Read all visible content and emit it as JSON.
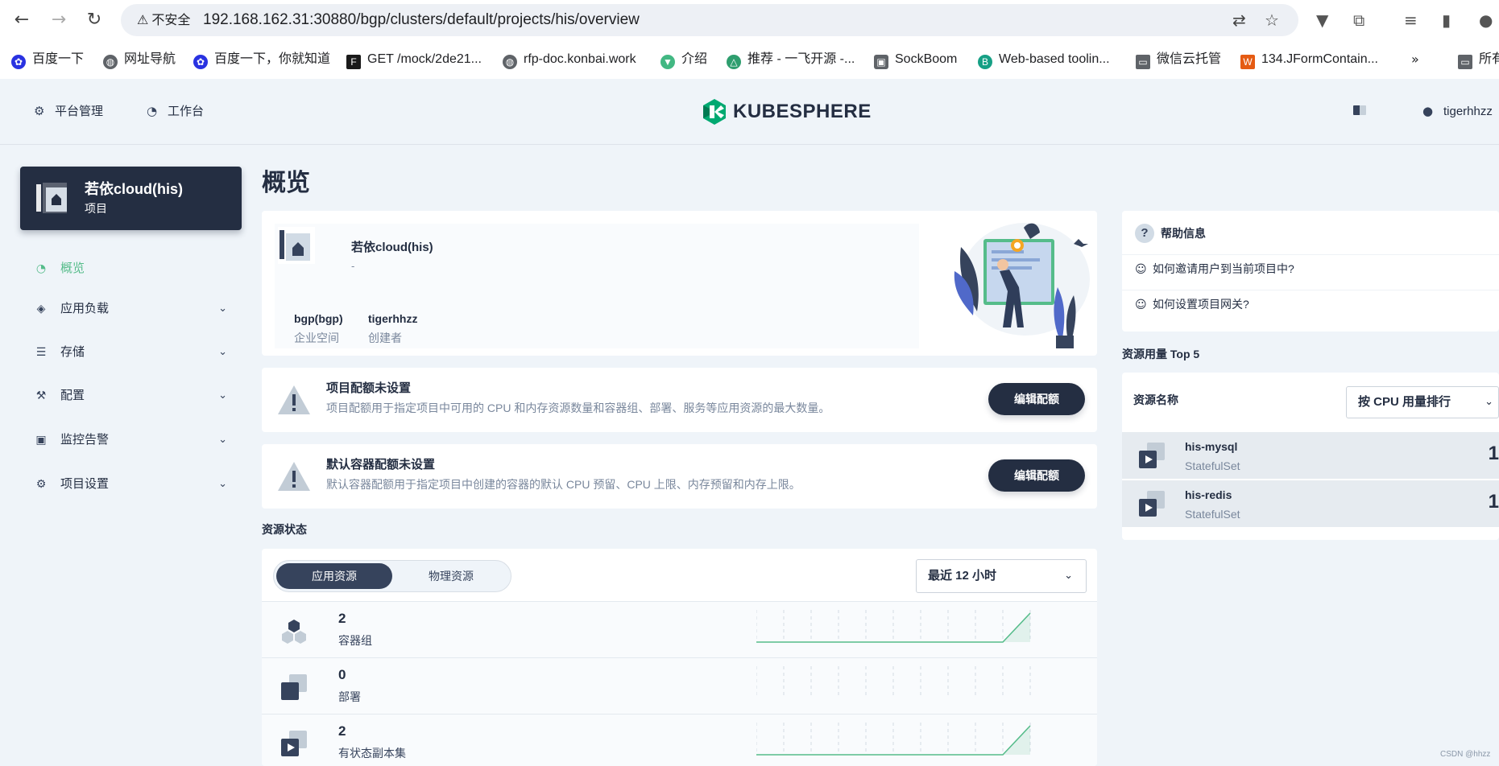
{
  "browser": {
    "security_label": "不安全",
    "url": "192.168.162.31:30880/bgp/clusters/default/projects/his/overview",
    "bookmarks": [
      {
        "label": "百度一下",
        "icon": "baidu-icon",
        "color": "#2932e1"
      },
      {
        "label": "网址导航",
        "icon": "globe-icon",
        "color": "#5f6368"
      },
      {
        "label": "百度一下，你就知道",
        "icon": "baidu-icon",
        "color": "#2932e1"
      },
      {
        "label": "GET /mock/2de21...",
        "icon": "f-icon",
        "color": "#1a1a1a"
      },
      {
        "label": "rfp-doc.konbai.work",
        "icon": "globe-icon",
        "color": "#5f6368"
      },
      {
        "label": "介绍",
        "icon": "vue-icon",
        "color": "#42b883"
      },
      {
        "label": "推荐 - 一飞开源 -...",
        "icon": "triangle-icon",
        "color": "#2e9e6e"
      },
      {
        "label": "SockBoom",
        "icon": "robot-icon",
        "color": "#5f6368"
      },
      {
        "label": "Web-based toolin...",
        "icon": "b-icon",
        "color": "#16a085"
      },
      {
        "label": "微信云托管",
        "icon": "folder-icon",
        "color": "#5f6368"
      },
      {
        "label": "134.JFormContain...",
        "icon": "w-icon",
        "color": "#e55b13"
      },
      {
        "label": "所有",
        "icon": "folder-icon",
        "color": "#5f6368"
      }
    ]
  },
  "topbar": {
    "platform_label": "平台管理",
    "workbench_label": "工作台",
    "logo_text": "KUBESPHERE",
    "user": "tigerhhzz"
  },
  "sidebar": {
    "project_name": "若依cloud(his)",
    "project_type": "项目",
    "items": [
      {
        "label": "概览",
        "icon": "dashboard-icon",
        "active": true
      },
      {
        "label": "应用负载",
        "icon": "layers-icon"
      },
      {
        "label": "存储",
        "icon": "database-icon"
      },
      {
        "label": "配置",
        "icon": "hammer-icon"
      },
      {
        "label": "监控告警",
        "icon": "monitor-icon"
      },
      {
        "label": "项目设置",
        "icon": "gear-icon"
      }
    ]
  },
  "main": {
    "title": "概览",
    "project": {
      "name": "若依cloud(his)",
      "desc": "-",
      "workspace_value": "bgp(bgp)",
      "workspace_label": "企业空间",
      "creator_value": "tigerhhzz",
      "creator_label": "创建者"
    },
    "quotas": [
      {
        "title": "项目配额未设置",
        "desc": "项目配额用于指定项目中可用的 CPU 和内存资源数量和容器组、部署、服务等应用资源的最大数量。",
        "button": "编辑配额"
      },
      {
        "title": "默认容器配额未设置",
        "desc": "默认容器配额用于指定项目中创建的容器的默认 CPU 预留、CPU 上限、内存预留和内存上限。",
        "button": "编辑配额"
      }
    ],
    "resource_status": {
      "title": "资源状态",
      "tabs": [
        "应用资源",
        "物理资源"
      ],
      "range": "最近 12 小时",
      "rows": [
        {
          "count": "2",
          "label": "容器组",
          "trend": [
            0,
            0,
            0,
            0,
            0,
            0,
            0,
            0,
            0,
            0,
            2
          ]
        },
        {
          "count": "0",
          "label": "部署",
          "trend": [
            0,
            0,
            0,
            0,
            0,
            0,
            0,
            0,
            0,
            0,
            0
          ]
        },
        {
          "count": "2",
          "label": "有状态副本集",
          "trend": [
            0,
            0,
            0,
            0,
            0,
            0,
            0,
            0,
            0,
            0,
            2
          ]
        }
      ]
    }
  },
  "help": {
    "title": "帮助信息",
    "items": [
      "如何邀请用户到当前项目中?",
      "如何设置项目网关?"
    ]
  },
  "top5": {
    "title": "资源用量 Top 5",
    "header": "资源名称",
    "sort": "按 CPU 用量排行",
    "rows": [
      {
        "name": "his-mysql",
        "type": "StatefulSet",
        "value": "1"
      },
      {
        "name": "his-redis",
        "type": "StatefulSet",
        "value": "1"
      }
    ]
  },
  "watermark": "CSDN @hhzz",
  "colors": {
    "accent": "#55bc8a",
    "dark": "#242e42",
    "bg": "#eff4f9"
  }
}
